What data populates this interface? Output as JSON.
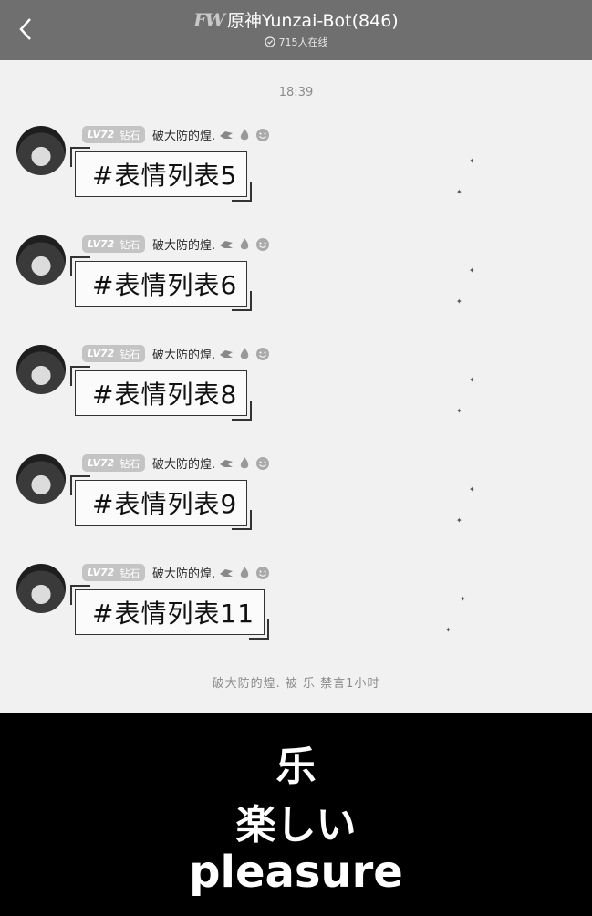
{
  "header": {
    "back_icon": "chevron-left-icon",
    "logo_text": "FW",
    "title": "原神Yunzai-Bot(846)",
    "online_count": "715人在线",
    "online_icon": "check-circle-icon"
  },
  "chat": {
    "timestamp": "18:39",
    "messages": [
      {
        "level": "LV72",
        "rank": "钻石",
        "sender": "破大防的煌.",
        "text": "#表情列表5"
      },
      {
        "level": "LV72",
        "rank": "钻石",
        "sender": "破大防的煌.",
        "text": "#表情列表6"
      },
      {
        "level": "LV72",
        "rank": "钻石",
        "sender": "破大防的煌.",
        "text": "#表情列表8"
      },
      {
        "level": "LV72",
        "rank": "钻石",
        "sender": "破大防的煌.",
        "text": "#表情列表9"
      },
      {
        "level": "LV72",
        "rank": "钻石",
        "sender": "破大防的煌.",
        "text": "#表情列表11"
      }
    ],
    "system_note": "破大防的煌. 被 乐 禁言1小时"
  },
  "caption": {
    "line1": "乐",
    "line2": "楽しい",
    "line3": "pleasure"
  },
  "colors": {
    "header_bg": "#6f6f6f",
    "chat_bg": "#f1f1f1",
    "badge_bg": "#c4c4c4",
    "caption_bg": "#000000"
  }
}
